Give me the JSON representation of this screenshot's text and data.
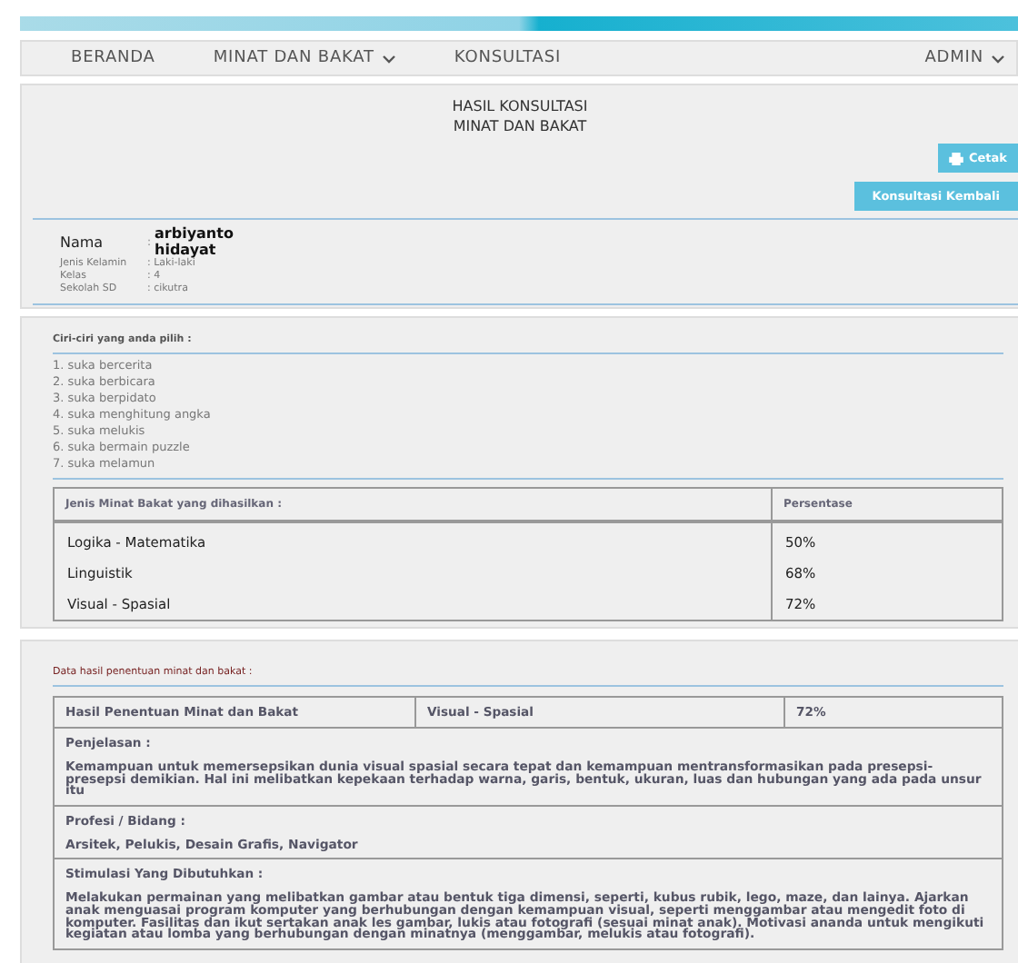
{
  "nav": {
    "items": [
      {
        "label": "BERANDA",
        "dropdown": false
      },
      {
        "label": "MINAT DAN BAKAT",
        "dropdown": true
      },
      {
        "label": "KONSULTASI",
        "dropdown": false
      }
    ],
    "user": {
      "label": "ADMIN",
      "dropdown": true
    }
  },
  "header": {
    "title_lines": [
      "HASIL KONSULTASI",
      "MINAT DAN BAKAT"
    ],
    "print_button": "Cetak",
    "again_button": "Konsultasi Kembali"
  },
  "profile": {
    "name_label": "Nama",
    "name_separator": ":",
    "name_value": "arbiyanto hidayat",
    "fields": [
      {
        "label": "Jenis Kelamin",
        "value": ": Laki-laki"
      },
      {
        "label": "Kelas",
        "value": ": 4"
      },
      {
        "label": "Sekolah SD",
        "value": ": cikutra"
      }
    ]
  },
  "traits": {
    "title": "Ciri-ciri yang anda pilih :",
    "items": [
      "1. suka bercerita",
      "2. suka berbicara",
      "3. suka berpidato",
      "4. suka menghitung angka",
      "5. suka melukis",
      "6. suka bermain puzzle",
      "7. suka melamun"
    ]
  },
  "results_table": {
    "columns": [
      "Jenis Minat Bakat yang dihasilkan :",
      "Persentase"
    ],
    "rows": [
      [
        "Logika - Matematika",
        "50%"
      ],
      [
        "Linguistik",
        "68%"
      ],
      [
        "Visual - Spasial",
        "72%"
      ]
    ]
  },
  "final": {
    "title": "Data hasil penentuan minat dan bakat :",
    "summary": [
      "Hasil Penentuan Minat dan Bakat",
      "Visual - Spasial",
      "72%"
    ],
    "sections": [
      {
        "heading": "Penjelasan :",
        "body": "Kemampuan untuk memersepsikan dunia visual spasial secara tepat dan kemampuan mentransformasikan pada presepsi-presepsi demikian. Hal ini melibatkan kepekaan terhadap warna, garis, bentuk, ukuran, luas dan hubungan yang ada pada unsur itu"
      },
      {
        "heading": "Profesi / Bidang :",
        "body": "Arsitek, Pelukis, Desain Grafis, Navigator"
      },
      {
        "heading": "Stimulasi Yang Dibutuhkan :",
        "body": "Melakukan permainan yang melibatkan gambar atau bentuk tiga dimensi, seperti, kubus rubik, lego, maze, dan lainya. Ajarkan anak menguasai program komputer yang berhubungan dengan kemampuan visual, seperti menggambar atau mengedit foto di komputer. Fasilitas dan ikut sertakan anak les gambar, lukis atau fotografi (sesuai minat anak). Motivasi ananda untuk mengikuti kegiatan atau lomba yang berhubungan dengan minatnya (menggambar, melukis atau fotografi)."
      }
    ]
  }
}
